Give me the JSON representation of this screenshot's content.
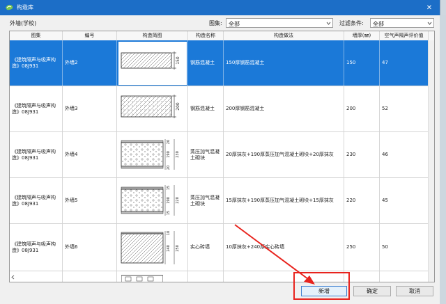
{
  "window": {
    "title": "构造库",
    "close_glyph": "✕"
  },
  "filter": {
    "scope": "外墙(学校)",
    "atlas_label": "图集:",
    "atlas_value": "全部",
    "condition_label": "过滤条件:",
    "condition_value": "全部"
  },
  "table": {
    "columns": [
      "图集",
      "编号",
      "构造简图",
      "构造名称",
      "构造做法",
      "墙厚(㎜)",
      "空气声隔声评价值"
    ],
    "rows": [
      {
        "atlas": "《建筑隔声与吸声构造》08J931",
        "code": "外墙2",
        "name": "钢筋混凝土",
        "method": "150厚钢筋混凝土",
        "thickness": "150",
        "rating": "47",
        "dims": [
          "150"
        ],
        "selected": true
      },
      {
        "atlas": "《建筑隔声与吸声构造》08J931",
        "code": "外墙3",
        "name": "钢筋混凝土",
        "method": "200厚钢筋混凝土",
        "thickness": "200",
        "rating": "52",
        "dims": [
          "200"
        ],
        "selected": false
      },
      {
        "atlas": "《建筑隔声与吸声构造》08J931",
        "code": "外墙4",
        "name": "蒸压加气混凝土砌块",
        "method": "20厚抹灰+190厚蒸压加气混凝土砌块+20厚抹灰",
        "thickness": "230",
        "rating": "46",
        "dims": [
          "20",
          "190",
          "20",
          "230"
        ],
        "selected": false
      },
      {
        "atlas": "《建筑隔声与吸声构造》08J931",
        "code": "外墙5",
        "name": "蒸压加气混凝土砌块",
        "method": "15厚抹灰+190厚蒸压加气混凝土砌块+15厚抹灰",
        "thickness": "220",
        "rating": "45",
        "dims": [
          "15",
          "190",
          "15",
          "220"
        ],
        "selected": false
      },
      {
        "atlas": "《建筑隔声与吸声构造》08J931",
        "code": "外墙6",
        "name": "实心砖墙",
        "method": "10厚抹灰+240厚实心砖墙",
        "thickness": "250",
        "rating": "50",
        "dims": [
          "10",
          "240",
          "250"
        ],
        "selected": false
      }
    ]
  },
  "buttons": {
    "add": "新增",
    "ok": "确定",
    "cancel": "取消"
  },
  "colors": {
    "titlebar": "#1c6ec7",
    "selection": "#1b79d8",
    "annotation": "#e8231d"
  }
}
